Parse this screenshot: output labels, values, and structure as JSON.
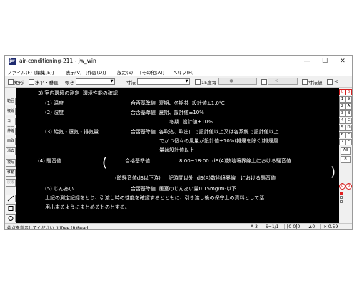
{
  "window": {
    "app_icon": "jw",
    "title": "air-conditioning-211 - jw_win",
    "controls": [
      "—",
      "☐",
      "✕"
    ]
  },
  "menubar": {
    "items": [
      "ファイル(F)",
      "[編集(E)]",
      "表示(V)",
      "[作図(D)]",
      "設定(S)",
      "[その他(A)]",
      "ヘルプ(H)"
    ]
  },
  "toolbar": {
    "rect_label": "矩形",
    "hv_label": "水平・垂直",
    "slope_label": "傾き",
    "dim_label": "寸法",
    "angle15_label": "15度毎",
    "arrow_btn1": "●———",
    "arrow_btn2": "<———",
    "dim_value_label": "寸法値",
    "lt_label": "<"
  },
  "leftbar": {
    "buttons": [
      "範囲",
      "複線",
      "コーナー",
      "伸縮",
      "面取",
      "消去",
      "複写",
      "移動",
      "戻る"
    ]
  },
  "drawing": {
    "lines": [
      "3) 室内環境の測定  環境性能の確認",
      "(1) 温度",
      "合否基準値  夏期、冬期共  設計値±1.0℃",
      "(2) 湿度",
      "合否基準値  夏期、設計値±10%",
      "冬期  設計値±10%",
      "(3) 給気・還気・排気量",
      "合否基準値  各吹込、吹出口で設計値以上又は各系統で設計値以上",
      "でかつ個々の風量が設計値±10%(排煙を除く)排煙風",
      "量は設計値以上",
      "(4) 騒音値",
      "合格基準値",
      "8:00~18:00  dB(A)数地境界線上における騒音値",
      "(暗騒音値dB以下時)  上記時間以外  dB(A)数地境界線上における騒音値",
      "(5) じんあい",
      "合否基準値  居室のじんあい量0.15mg/m³以下",
      "上記の測定記録をとり、引渡し時の性能を確認するとともに、引き渡し後の保守上の資料として活",
      "用出来るようにまとめるものとする。"
    ],
    "bracket_open": "(",
    "bracket_close": ")"
  },
  "rightbar": {
    "col_a": [
      "0",
      "1",
      "2",
      "3",
      "4",
      "5",
      "6",
      "7"
    ],
    "col_b": [
      "8",
      "9",
      "A",
      "B",
      "C",
      "D",
      "E",
      "F"
    ],
    "all_label": "All",
    "cross_label": "✕",
    "bottom_a": "0",
    "bottom_b": "8"
  },
  "statusbar": {
    "message": "始点を指示してください (L)free (R)Read",
    "paper": "A-3",
    "scale": "S=1/1",
    "layer": "[0-0]0",
    "angle": "∠0",
    "zoom": "× 0.59"
  },
  "colors": {
    "canvas": "#000000",
    "text": "#ffffff",
    "accent_red": "#d62020",
    "titlebar_icon": "#1e2a6e"
  }
}
